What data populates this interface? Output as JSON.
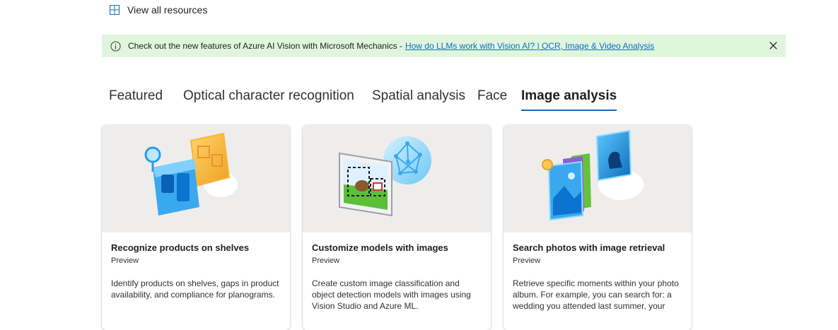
{
  "view_all": {
    "label": "View all resources"
  },
  "banner": {
    "text": "Check out the new features of Azure AI Vision with Microsoft Mechanics - ",
    "link": "How do LLMs work with Vision AI? | OCR, Image & Video Analysis"
  },
  "tabs": [
    {
      "label": "Featured",
      "active": false
    },
    {
      "label": "Optical character recognition",
      "active": false
    },
    {
      "label": "Spatial analysis",
      "active": false
    },
    {
      "label": "Face",
      "active": false
    },
    {
      "label": "Image analysis",
      "active": true
    }
  ],
  "cards": [
    {
      "title": "Recognize products on shelves",
      "badge": "Preview",
      "description": "Identify products on shelves, gaps in product availability, and compliance for planograms."
    },
    {
      "title": "Customize models with images",
      "badge": "Preview",
      "description": "Create custom image classification and object detection models with images using Vision Studio and Azure ML."
    },
    {
      "title": "Search photos with image retrieval",
      "badge": "Preview",
      "description": "Retrieve specific moments within your photo album. For example, you can search for: a wedding you attended last summer, your"
    }
  ],
  "colors": {
    "accent": "#0f6cbd",
    "banner_bg": "#dff6dd",
    "card_art_bg": "#eeedec"
  }
}
